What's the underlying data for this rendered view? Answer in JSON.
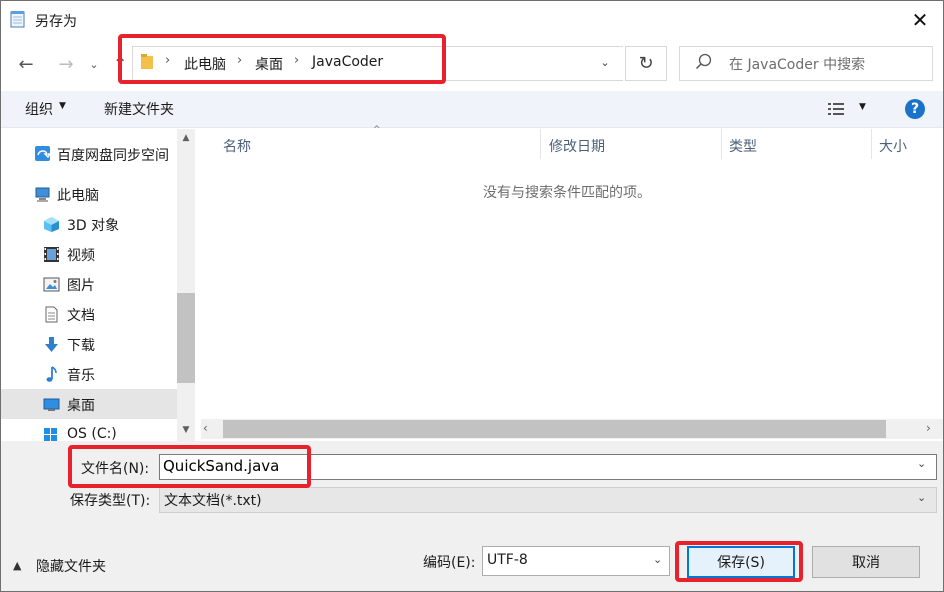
{
  "window": {
    "title": "另存为",
    "close": "✕"
  },
  "nav": {
    "back": "←",
    "forward": "→",
    "recent": "⌄",
    "up": "↑",
    "breadcrumb": [
      "此电脑",
      "桌面",
      "JavaCoder"
    ],
    "separator": "›",
    "refresh": "↻",
    "dropdown": "⌄",
    "search_placeholder": "在 JavaCoder 中搜索"
  },
  "toolbar": {
    "organize": "组织",
    "new_folder": "新建文件夹",
    "help": "?"
  },
  "sidebar": {
    "items": [
      {
        "label": "百度网盘同步空间",
        "icon": "cloud-sync-icon"
      },
      {
        "label": "此电脑",
        "icon": "computer-icon"
      },
      {
        "label": "3D 对象",
        "icon": "cube-icon"
      },
      {
        "label": "视频",
        "icon": "video-icon"
      },
      {
        "label": "图片",
        "icon": "picture-icon"
      },
      {
        "label": "文档",
        "icon": "document-icon"
      },
      {
        "label": "下载",
        "icon": "download-icon"
      },
      {
        "label": "音乐",
        "icon": "music-icon"
      },
      {
        "label": "桌面",
        "icon": "desktop-icon"
      },
      {
        "label": "OS (C:)",
        "icon": "drive-icon"
      }
    ],
    "selected": "桌面"
  },
  "filelist": {
    "columns": [
      "名称",
      "修改日期",
      "类型",
      "大小"
    ],
    "empty_message": "没有与搜索条件匹配的项。"
  },
  "form": {
    "filename_label": "文件名(N):",
    "filename_value": "QuickSand.java",
    "filetype_label": "保存类型(T):",
    "filetype_value": "文本文档(*.txt)",
    "hide_folders": "隐藏文件夹",
    "encoding_label": "编码(E):",
    "encoding_value": "UTF-8",
    "save": "保存(S)",
    "cancel": "取消"
  },
  "colors": {
    "accent": "#0078d7",
    "highlight": "#e8222d",
    "help": "#1a73c9"
  }
}
